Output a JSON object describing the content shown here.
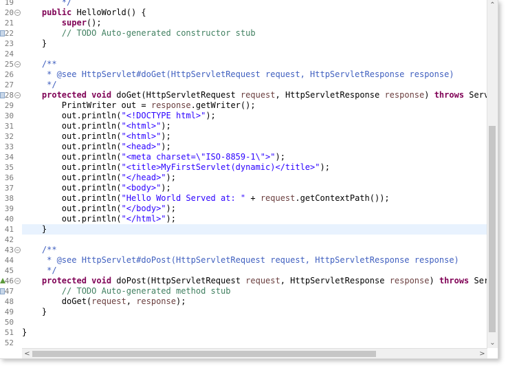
{
  "editor": {
    "first_line_number": 19,
    "current_line": 41,
    "lines": [
      {
        "n": "19",
        "fold": false,
        "marker": "",
        "tokens": [
          {
            "t": "        */",
            "c": "jd"
          }
        ]
      },
      {
        "n": "20",
        "fold": "⊖",
        "marker": "",
        "tokens": [
          {
            "t": "    ",
            "c": "pl"
          },
          {
            "t": "public",
            "c": "kw"
          },
          {
            "t": " HelloWorld() {",
            "c": "pl"
          }
        ]
      },
      {
        "n": "21",
        "fold": false,
        "marker": "",
        "tokens": [
          {
            "t": "        ",
            "c": "pl"
          },
          {
            "t": "super",
            "c": "kw"
          },
          {
            "t": "();",
            "c": "pl"
          }
        ]
      },
      {
        "n": "22",
        "fold": false,
        "marker": "task",
        "tokens": [
          {
            "t": "        ",
            "c": "pl"
          },
          {
            "t": "// TODO Auto-generated constructor stub",
            "c": "cm"
          }
        ]
      },
      {
        "n": "23",
        "fold": false,
        "marker": "",
        "tokens": [
          {
            "t": "    }",
            "c": "pl"
          }
        ]
      },
      {
        "n": "24",
        "fold": false,
        "marker": "",
        "tokens": []
      },
      {
        "n": "25",
        "fold": "⊖",
        "marker": "",
        "tokens": [
          {
            "t": "    /**",
            "c": "jd"
          }
        ]
      },
      {
        "n": "26",
        "fold": false,
        "marker": "",
        "tokens": [
          {
            "t": "     * @see HttpServlet#doGet(HttpServletRequest request, HttpServletResponse response)",
            "c": "jd"
          }
        ]
      },
      {
        "n": "27",
        "fold": false,
        "marker": "",
        "tokens": [
          {
            "t": "     */",
            "c": "jd"
          }
        ]
      },
      {
        "n": "28",
        "fold": "⊖",
        "marker": "task",
        "tokens": [
          {
            "t": "    ",
            "c": "pl"
          },
          {
            "t": "protected",
            "c": "kw"
          },
          {
            "t": " ",
            "c": "pl"
          },
          {
            "t": "void",
            "c": "kw"
          },
          {
            "t": " doGet(HttpServletRequest ",
            "c": "pl"
          },
          {
            "t": "request",
            "c": "param"
          },
          {
            "t": ", HttpServletResponse ",
            "c": "pl"
          },
          {
            "t": "response",
            "c": "param"
          },
          {
            "t": ") ",
            "c": "pl"
          },
          {
            "t": "throws",
            "c": "kw"
          },
          {
            "t": " ServletException",
            "c": "pl"
          }
        ]
      },
      {
        "n": "29",
        "fold": false,
        "marker": "",
        "tokens": [
          {
            "t": "        PrintWriter out = ",
            "c": "pl"
          },
          {
            "t": "response",
            "c": "param"
          },
          {
            "t": ".getWriter();",
            "c": "pl"
          }
        ]
      },
      {
        "n": "30",
        "fold": false,
        "marker": "",
        "tokens": [
          {
            "t": "        out.println(",
            "c": "pl"
          },
          {
            "t": "\"<!DOCTYPE html>\"",
            "c": "st"
          },
          {
            "t": ");",
            "c": "pl"
          }
        ]
      },
      {
        "n": "31",
        "fold": false,
        "marker": "",
        "tokens": [
          {
            "t": "        out.println(",
            "c": "pl"
          },
          {
            "t": "\"<html>\"",
            "c": "st"
          },
          {
            "t": ");",
            "c": "pl"
          }
        ]
      },
      {
        "n": "32",
        "fold": false,
        "marker": "",
        "tokens": [
          {
            "t": "        out.println(",
            "c": "pl"
          },
          {
            "t": "\"<html>\"",
            "c": "st"
          },
          {
            "t": ");",
            "c": "pl"
          }
        ]
      },
      {
        "n": "33",
        "fold": false,
        "marker": "",
        "tokens": [
          {
            "t": "        out.println(",
            "c": "pl"
          },
          {
            "t": "\"<head>\"",
            "c": "st"
          },
          {
            "t": ");",
            "c": "pl"
          }
        ]
      },
      {
        "n": "34",
        "fold": false,
        "marker": "",
        "tokens": [
          {
            "t": "        out.println(",
            "c": "pl"
          },
          {
            "t": "\"<meta charset=\\\"ISO-8859-1\\\">\"",
            "c": "st"
          },
          {
            "t": ");",
            "c": "pl"
          }
        ]
      },
      {
        "n": "35",
        "fold": false,
        "marker": "",
        "tokens": [
          {
            "t": "        out.println(",
            "c": "pl"
          },
          {
            "t": "\"<title>MyFirstServlet(dynamic)</title>\"",
            "c": "st"
          },
          {
            "t": ");",
            "c": "pl"
          }
        ]
      },
      {
        "n": "36",
        "fold": false,
        "marker": "",
        "tokens": [
          {
            "t": "        out.println(",
            "c": "pl"
          },
          {
            "t": "\"</head>\"",
            "c": "st"
          },
          {
            "t": ");",
            "c": "pl"
          }
        ]
      },
      {
        "n": "37",
        "fold": false,
        "marker": "",
        "tokens": [
          {
            "t": "        out.println(",
            "c": "pl"
          },
          {
            "t": "\"<body>\"",
            "c": "st"
          },
          {
            "t": ");",
            "c": "pl"
          }
        ]
      },
      {
        "n": "38",
        "fold": false,
        "marker": "",
        "tokens": [
          {
            "t": "        out.println(",
            "c": "pl"
          },
          {
            "t": "\"Hello World Served at: \"",
            "c": "st"
          },
          {
            "t": " + ",
            "c": "pl"
          },
          {
            "t": "request",
            "c": "param"
          },
          {
            "t": ".getContextPath());",
            "c": "pl"
          }
        ]
      },
      {
        "n": "39",
        "fold": false,
        "marker": "",
        "tokens": [
          {
            "t": "        out.println(",
            "c": "pl"
          },
          {
            "t": "\"</body>\"",
            "c": "st"
          },
          {
            "t": ");",
            "c": "pl"
          }
        ]
      },
      {
        "n": "40",
        "fold": false,
        "marker": "",
        "tokens": [
          {
            "t": "        out.println(",
            "c": "pl"
          },
          {
            "t": "\"</html>\"",
            "c": "st"
          },
          {
            "t": ");",
            "c": "pl"
          }
        ]
      },
      {
        "n": "41",
        "fold": false,
        "marker": "",
        "tokens": [
          {
            "t": "    }",
            "c": "pl"
          }
        ]
      },
      {
        "n": "42",
        "fold": false,
        "marker": "",
        "tokens": []
      },
      {
        "n": "43",
        "fold": "⊖",
        "marker": "",
        "tokens": [
          {
            "t": "    /**",
            "c": "jd"
          }
        ]
      },
      {
        "n": "44",
        "fold": false,
        "marker": "",
        "tokens": [
          {
            "t": "     * @see HttpServlet#doPost(HttpServletRequest request, HttpServletResponse response)",
            "c": "jd"
          }
        ]
      },
      {
        "n": "45",
        "fold": false,
        "marker": "",
        "tokens": [
          {
            "t": "     */",
            "c": "jd"
          }
        ]
      },
      {
        "n": "46",
        "fold": "⊖",
        "marker": "override",
        "tokens": [
          {
            "t": "    ",
            "c": "pl"
          },
          {
            "t": "protected",
            "c": "kw"
          },
          {
            "t": " ",
            "c": "pl"
          },
          {
            "t": "void",
            "c": "kw"
          },
          {
            "t": " doPost(HttpServletRequest ",
            "c": "pl"
          },
          {
            "t": "request",
            "c": "param"
          },
          {
            "t": ", HttpServletResponse ",
            "c": "pl"
          },
          {
            "t": "response",
            "c": "param"
          },
          {
            "t": ") ",
            "c": "pl"
          },
          {
            "t": "throws",
            "c": "kw"
          },
          {
            "t": " ServletException",
            "c": "pl"
          }
        ]
      },
      {
        "n": "47",
        "fold": false,
        "marker": "task",
        "tokens": [
          {
            "t": "        ",
            "c": "pl"
          },
          {
            "t": "// TODO Auto-generated method stub",
            "c": "cm"
          }
        ]
      },
      {
        "n": "48",
        "fold": false,
        "marker": "",
        "tokens": [
          {
            "t": "        doGet(",
            "c": "pl"
          },
          {
            "t": "request",
            "c": "param"
          },
          {
            "t": ", ",
            "c": "pl"
          },
          {
            "t": "response",
            "c": "param"
          },
          {
            "t": ");",
            "c": "pl"
          }
        ]
      },
      {
        "n": "49",
        "fold": false,
        "marker": "",
        "tokens": [
          {
            "t": "    }",
            "c": "pl"
          }
        ]
      },
      {
        "n": "50",
        "fold": false,
        "marker": "",
        "tokens": []
      },
      {
        "n": "51",
        "fold": false,
        "marker": "",
        "tokens": [
          {
            "t": "}",
            "c": "pl"
          }
        ]
      },
      {
        "n": "52",
        "fold": false,
        "marker": "",
        "tokens": []
      }
    ]
  },
  "scrollbars": {
    "vertical_up_icon": "scroll-up-arrow-icon",
    "vertical_down_icon": "scroll-down-arrow-icon",
    "horizontal_left_icon": "scroll-left-arrow-icon",
    "horizontal_right_icon": "scroll-right-arrow-icon",
    "up_glyph": "⌃",
    "down_glyph": "⌄",
    "left_glyph": "<",
    "right_glyph": ">"
  }
}
